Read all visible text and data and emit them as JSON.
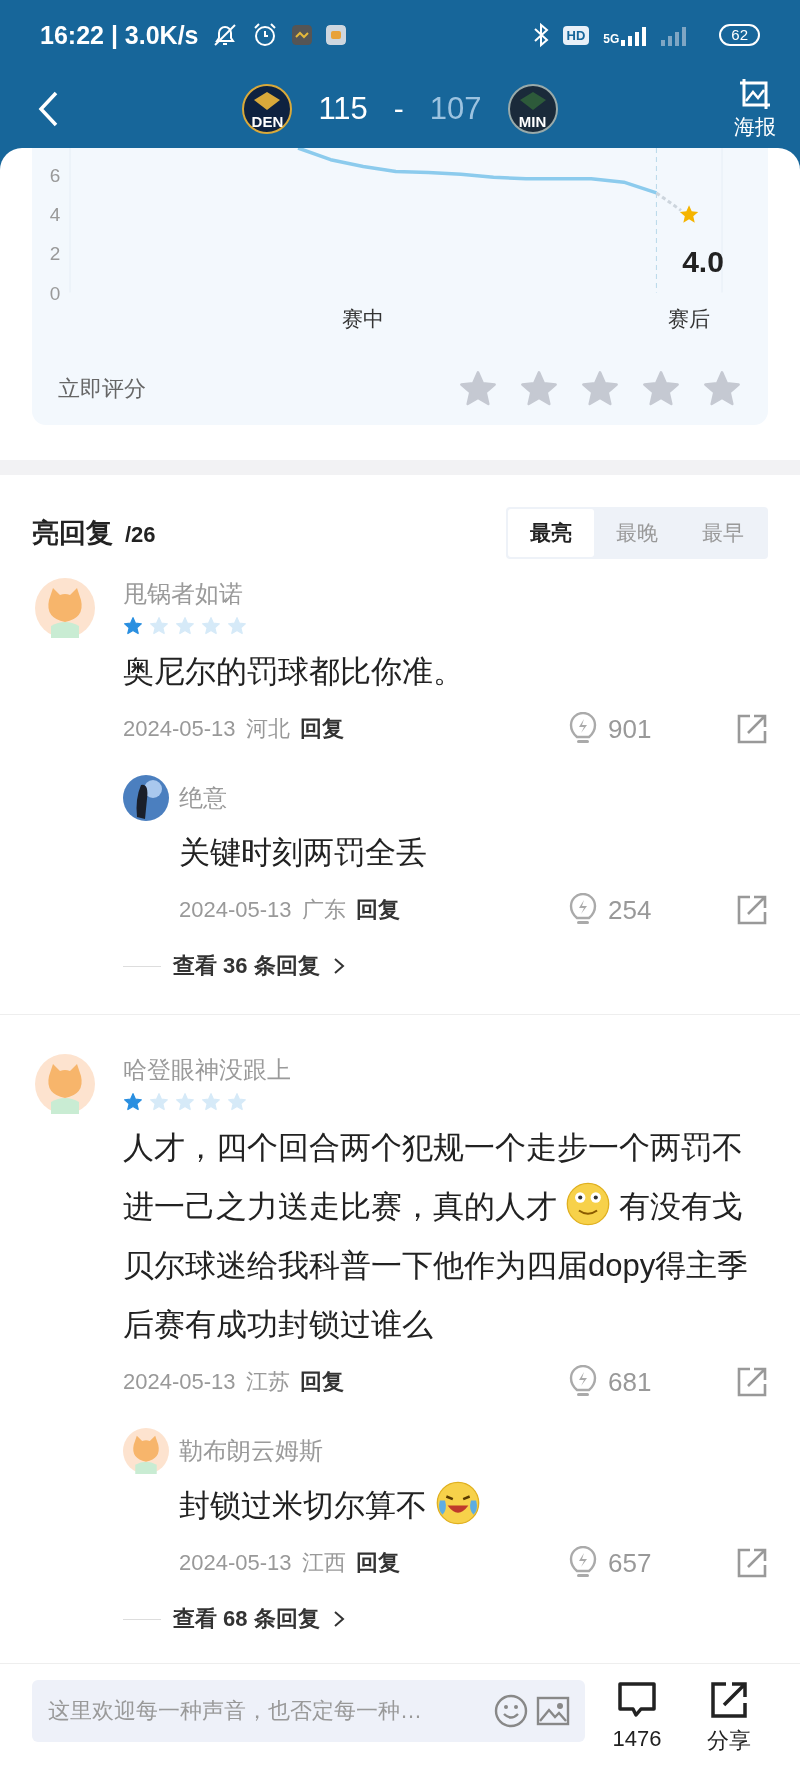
{
  "status_bar": {
    "time": "16:22 | 3.0K/s",
    "hd": "HD",
    "network": "5G",
    "battery": "62"
  },
  "header": {
    "teams": [
      {
        "abbr": "DEN",
        "score": "115",
        "leading": true
      },
      {
        "abbr": "MIN",
        "score": "107",
        "leading": false
      }
    ],
    "separator": "-",
    "poster_label": "海报"
  },
  "rating": {
    "chart_data": {
      "type": "line",
      "categories": [
        null,
        null,
        null,
        null,
        null,
        null,
        null,
        null,
        null,
        "赛中",
        null,
        null,
        null,
        null,
        null,
        null,
        null,
        null,
        null,
        "赛后"
      ],
      "ylim": [
        0,
        7.4
      ],
      "yticks": [
        0,
        2,
        4,
        6
      ],
      "series": [
        {
          "color": "#8ccbed",
          "values": [
            null,
            null,
            null,
            null,
            null,
            null,
            null,
            7.4,
            6.8,
            6.45,
            6.2,
            6.15,
            6.05,
            5.9,
            5.82,
            5.82,
            5.82,
            5.65,
            5.1,
            null
          ]
        }
      ],
      "annotations": [
        {
          "x": "赛后",
          "y": 4.0,
          "text": "4.0"
        }
      ]
    },
    "rate_label": "立即评分",
    "stars": 0
  },
  "replies_section": {
    "title": "亮回复",
    "count": "/26",
    "tabs": [
      {
        "label": "最亮",
        "selected": true
      },
      {
        "label": "最晚",
        "selected": false
      },
      {
        "label": "最早",
        "selected": false
      }
    ]
  },
  "comments": [
    {
      "user": {
        "name": "甩锅者如诺",
        "avatar": {
          "kind": "cartoon"
        }
      },
      "stars": 1,
      "text": [
        {
          "kind": "text",
          "text": "奥尼尔的罚球都比你准。"
        }
      ],
      "date": "2024-05-13",
      "region": "河北",
      "reply_label": "回复",
      "likes": "901",
      "replies": [
        {
          "user": {
            "name": "绝意",
            "avatar": {
              "kind": "photo"
            }
          },
          "text": [
            {
              "kind": "text",
              "text": "关键时刻两罚全丢"
            }
          ],
          "date": "2024-05-13",
          "region": "广东",
          "reply_label": "回复",
          "likes": "254"
        }
      ],
      "more_replies": "查看 36 条回复"
    },
    {
      "user": {
        "name": "哈登眼神没跟上",
        "avatar": {
          "kind": "cartoon"
        }
      },
      "stars": 1,
      "text": [
        {
          "kind": "text",
          "text": "人才，四个回合两个犯规一个走步一个两罚不进一己之力送走比赛，真的人才"
        },
        {
          "kind": "smile"
        },
        {
          "kind": "text",
          "text": "有没有戈贝尔球迷给我科普一下他作为四届dopy得主季后赛有成功封锁过谁么"
        }
      ],
      "date": "2024-05-13",
      "region": "江苏",
      "reply_label": "回复",
      "likes": "681",
      "replies": [
        {
          "user": {
            "name": "勒布朗云姆斯",
            "avatar": {
              "kind": "cartoon"
            }
          },
          "text": [
            {
              "kind": "text",
              "text": "封锁过米切尔算不"
            },
            {
              "kind": "laugh"
            }
          ],
          "date": "2024-05-13",
          "region": "江西",
          "reply_label": "回复",
          "likes": "657"
        }
      ],
      "more_replies": "查看 68 条回复"
    }
  ],
  "bottom_bar": {
    "placeholder": "这里欢迎每一种声音，也否定每一种…",
    "comment_count": "1476",
    "share_label": "分享"
  }
}
